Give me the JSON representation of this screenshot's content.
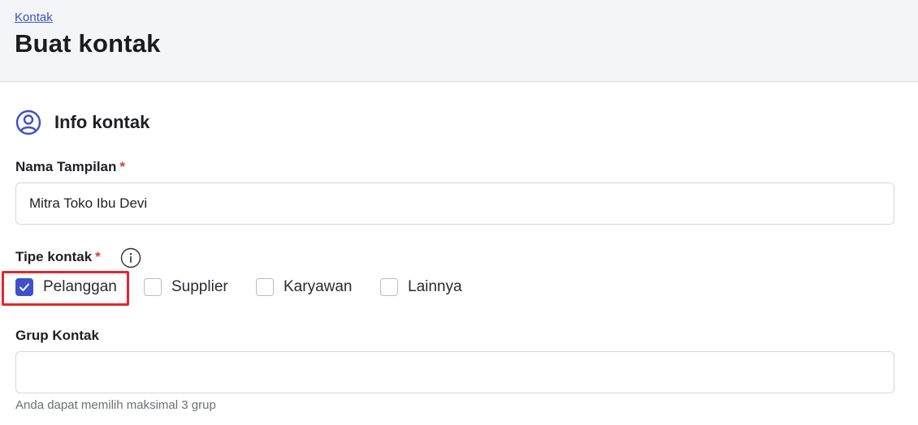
{
  "header": {
    "breadcrumb": "Kontak",
    "title": "Buat kontak"
  },
  "section": {
    "title": "Info kontak",
    "icon": "user-circle-icon"
  },
  "display_name": {
    "label": "Nama Tampilan",
    "required_mark": "*",
    "value": "Mitra Toko Ibu Devi"
  },
  "contact_type": {
    "label": "Tipe kontak",
    "required_mark": "*",
    "info_icon": "info-icon",
    "options": [
      {
        "label": "Pelanggan",
        "checked": true
      },
      {
        "label": "Supplier",
        "checked": false
      },
      {
        "label": "Karyawan",
        "checked": false
      },
      {
        "label": "Lainnya",
        "checked": false
      }
    ]
  },
  "contact_group": {
    "label": "Grup Kontak",
    "value": "",
    "hint": "Anda dapat memilih maksimal 3 grup"
  },
  "colors": {
    "accent": "#3f51c8",
    "required": "#d23c3c",
    "highlight": "#e5262b",
    "header_bg": "#f3f5f9"
  }
}
